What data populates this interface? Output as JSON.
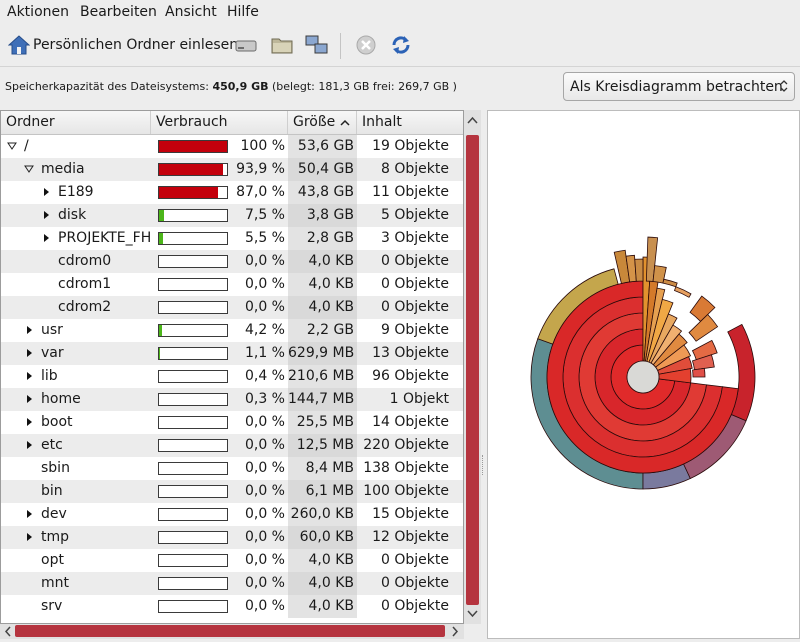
{
  "menu": {
    "items": [
      {
        "label": "Aktionen"
      },
      {
        "label": "Bearbeiten"
      },
      {
        "label": "Ansicht"
      },
      {
        "label": "Hilfe"
      }
    ]
  },
  "toolbar": {
    "scan_home_label": "Persönlichen Ordner einlesen",
    "icons": [
      "home-icon",
      "drive-icon",
      "folder-icon",
      "network-icon",
      "stop-icon",
      "refresh-icon"
    ]
  },
  "info": {
    "prefix": "Speicherkapazität des Dateisystems:",
    "total": "450,9 GB",
    "detail": "(belegt: 181,3 GB frei: 269,7 GB )"
  },
  "view_select": {
    "value": "Als Kreisdiagramm betrachten"
  },
  "table": {
    "columns": {
      "name": "Ordner",
      "usage": "Verbrauch",
      "size": "Größe",
      "contents": "Inhalt"
    },
    "rows": [
      {
        "name": "/",
        "level": 0,
        "expander": "open",
        "percent": "100 %",
        "usage": 100,
        "size": "53,6 GB",
        "contents": "19 Objekte"
      },
      {
        "name": "media",
        "level": 1,
        "expander": "open",
        "percent": "93,9 %",
        "usage": 93.9,
        "size": "50,4 GB",
        "contents": "8 Objekte"
      },
      {
        "name": "E189",
        "level": 2,
        "expander": "closed",
        "percent": "87,0 %",
        "usage": 87.0,
        "size": "43,8 GB",
        "contents": "11 Objekte"
      },
      {
        "name": "disk",
        "level": 2,
        "expander": "closed",
        "percent": "7,5 %",
        "usage": 7.5,
        "size": "3,8 GB",
        "contents": "5 Objekte"
      },
      {
        "name": "PROJEKTE_FH",
        "level": 2,
        "expander": "closed",
        "percent": "5,5 %",
        "usage": 5.5,
        "size": "2,8 GB",
        "contents": "3 Objekte"
      },
      {
        "name": "cdrom0",
        "level": 2,
        "expander": "none",
        "percent": "0,0 %",
        "usage": 0,
        "size": "4,0 KB",
        "contents": "0 Objekte"
      },
      {
        "name": "cdrom1",
        "level": 2,
        "expander": "none",
        "percent": "0,0 %",
        "usage": 0,
        "size": "4,0 KB",
        "contents": "0 Objekte"
      },
      {
        "name": "cdrom2",
        "level": 2,
        "expander": "none",
        "percent": "0,0 %",
        "usage": 0,
        "size": "4,0 KB",
        "contents": "0 Objekte"
      },
      {
        "name": "usr",
        "level": 1,
        "expander": "closed",
        "percent": "4,2 %",
        "usage": 4.2,
        "size": "2,2 GB",
        "contents": "9 Objekte"
      },
      {
        "name": "var",
        "level": 1,
        "expander": "closed",
        "percent": "1,1 %",
        "usage": 1.1,
        "size": "629,9 MB",
        "contents": "13 Objekte"
      },
      {
        "name": "lib",
        "level": 1,
        "expander": "closed",
        "percent": "0,4 %",
        "usage": 0.4,
        "size": "210,6 MB",
        "contents": "96 Objekte"
      },
      {
        "name": "home",
        "level": 1,
        "expander": "closed",
        "percent": "0,3 %",
        "usage": 0.3,
        "size": "144,7 MB",
        "contents": "1 Objekt"
      },
      {
        "name": "boot",
        "level": 1,
        "expander": "closed",
        "percent": "0,0 %",
        "usage": 0,
        "size": "25,5 MB",
        "contents": "14 Objekte"
      },
      {
        "name": "etc",
        "level": 1,
        "expander": "closed",
        "percent": "0,0 %",
        "usage": 0,
        "size": "12,5 MB",
        "contents": "220 Objekte"
      },
      {
        "name": "sbin",
        "level": 1,
        "expander": "none",
        "percent": "0,0 %",
        "usage": 0,
        "size": "8,4 MB",
        "contents": "138 Objekte"
      },
      {
        "name": "bin",
        "level": 1,
        "expander": "none",
        "percent": "0,0 %",
        "usage": 0,
        "size": "6,1 MB",
        "contents": "100 Objekte"
      },
      {
        "name": "dev",
        "level": 1,
        "expander": "closed",
        "percent": "0,0 %",
        "usage": 0,
        "size": "260,0 KB",
        "contents": "15 Objekte"
      },
      {
        "name": "tmp",
        "level": 1,
        "expander": "closed",
        "percent": "0,0 %",
        "usage": 0,
        "size": "60,0 KB",
        "contents": "12 Objekte"
      },
      {
        "name": "opt",
        "level": 1,
        "expander": "none",
        "percent": "0,0 %",
        "usage": 0,
        "size": "4,0 KB",
        "contents": "0 Objekte"
      },
      {
        "name": "mnt",
        "level": 1,
        "expander": "none",
        "percent": "0,0 %",
        "usage": 0,
        "size": "4,0 KB",
        "contents": "0 Objekte"
      },
      {
        "name": "srv",
        "level": 1,
        "expander": "none",
        "percent": "0,0 %",
        "usage": 0,
        "size": "4,0 KB",
        "contents": "0 Objekte"
      }
    ]
  },
  "colors": {
    "bar_red": "#c4000c",
    "bar_green": "#4cb61a",
    "scroll_thumb": "#b5343f"
  }
}
